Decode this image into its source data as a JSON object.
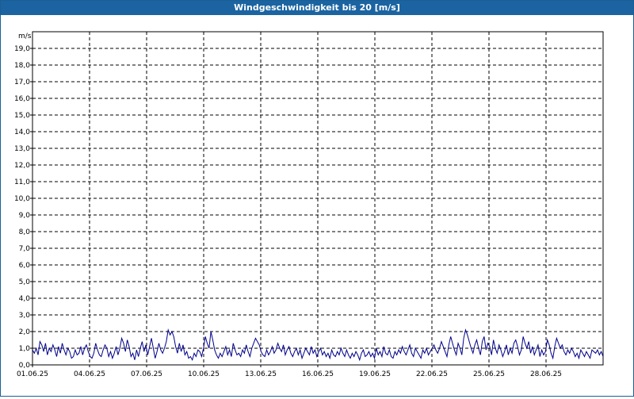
{
  "window": {
    "title": "Windgeschwindigkeit bis 20 [m/s]"
  },
  "chart_data": {
    "type": "line",
    "title": "Windgeschwindigkeit bis 20 [m/s]",
    "ylabel": "m/s",
    "xlabel": "",
    "ylim": [
      0,
      20
    ],
    "y_ticks": [
      "0,0",
      "1,0",
      "2,0",
      "3,0",
      "4,0",
      "5,0",
      "6,0",
      "7,0",
      "8,0",
      "9,0",
      "10,0",
      "11,0",
      "12,0",
      "13,0",
      "14,0",
      "15,0",
      "16,0",
      "17,0",
      "18,0",
      "19,0"
    ],
    "x_ticks": [
      "01.06.25",
      "04.06.25",
      "07.06.25",
      "10.06.25",
      "13.06.25",
      "16.06.25",
      "19.06.25",
      "22.06.25",
      "25.06.25",
      "28.06.25"
    ],
    "x_range_days": [
      0,
      30
    ],
    "grid": true,
    "line_color": "#00008b",
    "series": [
      {
        "values": [
          0.9,
          0.7,
          1.0,
          0.6,
          1.4,
          1.2,
          0.8,
          1.3,
          0.6,
          1.0,
          0.8,
          1.2,
          0.9,
          0.5,
          1.1,
          0.7,
          1.3,
          0.9,
          0.6,
          1.0,
          0.8,
          0.4,
          0.5,
          0.9,
          0.6,
          0.7,
          1.1,
          0.6,
          1.0,
          1.2,
          0.8,
          0.5,
          0.4,
          0.7,
          1.3,
          0.9,
          0.6,
          0.5,
          0.9,
          1.2,
          1.0,
          0.5,
          0.8,
          0.4,
          0.7,
          1.1,
          0.6,
          1.0,
          1.6,
          1.3,
          0.8,
          1.5,
          1.1,
          0.5,
          0.7,
          0.3,
          0.9,
          0.5,
          1.0,
          1.4,
          0.8,
          1.2,
          0.6,
          1.1,
          1.6,
          1.0,
          0.4,
          0.8,
          1.3,
          0.9,
          0.7,
          1.0,
          1.4,
          2.1,
          1.8,
          2.0,
          1.7,
          1.1,
          0.7,
          1.3,
          0.8,
          1.2,
          0.6,
          0.8,
          0.4,
          0.5,
          0.3,
          0.7,
          0.5,
          0.9,
          0.8,
          0.5,
          1.0,
          1.7,
          1.3,
          1.0,
          2.0,
          1.5,
          0.9,
          0.6,
          0.4,
          0.7,
          0.5,
          0.8,
          1.1,
          0.6,
          0.9,
          0.5,
          1.3,
          0.9,
          0.6,
          0.7,
          0.5,
          0.9,
          0.7,
          1.2,
          0.8,
          0.5,
          1.0,
          1.3,
          1.6,
          1.4,
          1.2,
          0.8,
          0.6,
          0.5,
          0.9,
          0.6,
          0.8,
          1.1,
          0.7,
          0.9,
          1.3,
          1.0,
          0.8,
          1.2,
          0.6,
          0.9,
          1.1,
          0.7,
          0.5,
          0.8,
          1.0,
          0.6,
          0.9,
          0.4,
          0.7,
          1.0,
          0.8,
          0.6,
          1.1,
          0.7,
          0.9,
          0.5,
          0.8,
          1.0,
          0.6,
          0.8,
          0.5,
          0.7,
          0.4,
          0.9,
          0.6,
          0.5,
          0.8,
          0.6,
          1.0,
          0.7,
          0.5,
          0.9,
          0.6,
          0.4,
          0.7,
          0.5,
          0.8,
          0.6,
          0.3,
          0.7,
          0.9,
          0.5,
          0.6,
          0.8,
          0.5,
          0.7,
          0.4,
          1.0,
          0.6,
          0.8,
          0.5,
          1.1,
          0.7,
          0.6,
          0.9,
          0.5,
          0.4,
          0.8,
          0.6,
          0.9,
          0.7,
          1.1,
          0.8,
          0.6,
          0.9,
          1.2,
          0.7,
          0.5,
          1.0,
          0.8,
          0.6,
          0.4,
          0.9,
          0.7,
          1.0,
          0.6,
          0.8,
          1.0,
          1.2,
          0.9,
          0.7,
          1.0,
          1.4,
          1.1,
          0.8,
          0.5,
          1.2,
          1.7,
          1.3,
          0.9,
          0.6,
          1.3,
          1.0,
          0.6,
          1.6,
          2.1,
          1.8,
          1.4,
          1.0,
          0.7,
          1.2,
          1.5,
          1.0,
          0.6,
          1.4,
          1.7,
          0.9,
          1.3,
          1.1,
          0.6,
          1.5,
          1.0,
          0.7,
          1.2,
          0.9,
          0.5,
          0.8,
          1.2,
          0.6,
          1.0,
          0.7,
          1.3,
          1.5,
          1.1,
          0.6,
          0.9,
          1.7,
          1.3,
          1.0,
          1.4,
          0.7,
          1.1,
          0.6,
          0.9,
          1.2,
          0.5,
          0.9,
          0.6,
          0.8,
          1.5,
          1.2,
          0.7,
          0.4,
          1.1,
          1.6,
          1.3,
          1.0,
          1.2,
          0.8,
          0.6,
          0.9,
          0.7,
          1.0,
          0.8,
          0.5,
          0.7,
          0.4,
          0.9,
          0.7,
          0.5,
          0.8,
          0.6,
          0.4,
          0.9,
          0.8,
          0.7,
          0.9,
          0.6,
          0.8,
          0.5
        ]
      }
    ]
  }
}
